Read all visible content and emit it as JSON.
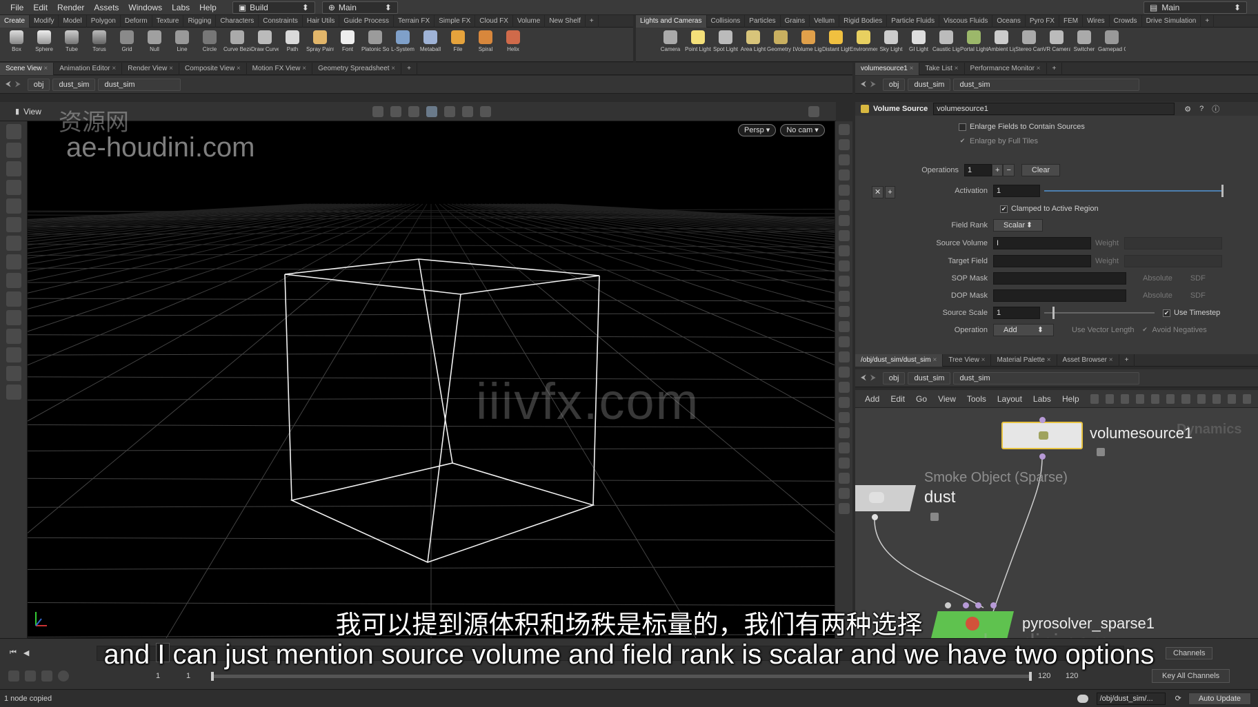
{
  "menubar": {
    "items": [
      "File",
      "Edit",
      "Render",
      "Assets",
      "Windows",
      "Labs",
      "Help"
    ],
    "desktop_build": "Build",
    "desktop_main": "Main",
    "right_desktop": "Main"
  },
  "shelf_left": {
    "tabs": [
      "Create",
      "Modify",
      "Model",
      "Polygon",
      "Deform",
      "Texture",
      "Rigging",
      "Characters",
      "Constraints",
      "Hair Utils",
      "Guide Process",
      "Terrain FX",
      "Simple FX",
      "Cloud FX",
      "Volume",
      "New Shelf"
    ],
    "tools": [
      "Box",
      "Sphere",
      "Tube",
      "Torus",
      "Grid",
      "Null",
      "Line",
      "Circle",
      "Curve Bezier",
      "Draw Curve",
      "Path",
      "Spray Paint",
      "Font",
      "Platonic Solids",
      "L-System",
      "Metaball",
      "File",
      "Spiral",
      "Helix"
    ]
  },
  "shelf_right": {
    "tabs": [
      "Lights and Cameras",
      "Collisions",
      "Particles",
      "Grains",
      "Vellum",
      "Rigid Bodies",
      "Particle Fluids",
      "Viscous Fluids",
      "Oceans",
      "Pyro FX",
      "FEM",
      "Wires",
      "Crowds",
      "Drive Simulation"
    ],
    "tools": [
      "Camera",
      "Point Light",
      "Spot Light",
      "Area Light",
      "Geometry Light",
      "Volume Light",
      "Distant Light",
      "Environment Light",
      "Sky Light",
      "GI Light",
      "Caustic Light",
      "Portal Light",
      "Ambient Light",
      "Stereo Camera",
      "VR Camera",
      "Switcher",
      "Gamepad Camera"
    ]
  },
  "left_pane": {
    "tabs": [
      "Scene View",
      "Animation Editor",
      "Render View",
      "Composite View",
      "Motion FX View",
      "Geometry Spreadsheet"
    ],
    "path": [
      "obj",
      "dust_sim",
      "dust_sim"
    ],
    "view_label": "View",
    "persp": "Persp",
    "nocam": "No cam"
  },
  "param_pane": {
    "tabs": [
      "volumesource1",
      "Take List",
      "Performance Monitor"
    ],
    "path": [
      "obj",
      "dust_sim",
      "dust_sim"
    ],
    "node_type": "Volume Source",
    "node_name": "volumesource1",
    "enlarge_fields": "Enlarge Fields to Contain Sources",
    "enlarge_tiles": "Enlarge by Full Tiles",
    "operations_label": "Operations",
    "operations_value": "1",
    "clear": "Clear",
    "activation_label": "Activation",
    "activation_value": "1",
    "clamped": "Clamped to Active Region",
    "field_rank_label": "Field Rank",
    "field_rank_value": "Scalar",
    "source_volume_label": "Source Volume",
    "target_field_label": "Target Field",
    "weight": "Weight",
    "sop_mask_label": "SOP Mask",
    "dop_mask_label": "DOP Mask",
    "absolute": "Absolute",
    "sdf": "SDF",
    "source_scale_label": "Source Scale",
    "source_scale_value": "1",
    "use_timestep": "Use Timestep",
    "operation_label": "Operation",
    "operation_value": "Add",
    "use_vector_length": "Use Vector Length",
    "avoid_negatives": "Avoid Negatives"
  },
  "net_pane": {
    "tabs": [
      "/obj/dust_sim/dust_sim",
      "Tree View",
      "Material Palette",
      "Asset Browser"
    ],
    "path": [
      "obj",
      "dust_sim",
      "dust_sim"
    ],
    "menu": [
      "Add",
      "Edit",
      "Go",
      "View",
      "Tools",
      "Layout",
      "Labs",
      "Help"
    ],
    "context_label": "Dynamics",
    "nodes": {
      "volumesource": "volumesource1",
      "dust_type": "Smoke Object (Sparse)",
      "dust": "dust",
      "pyrosolver": "pyrosolver_sparse1"
    }
  },
  "timeline": {
    "frame": "1",
    "start": "1",
    "end": "120",
    "end2": "120",
    "channels": "Channels",
    "key_all": "Key All Channels"
  },
  "status": {
    "message": "1 node copied",
    "path": "/obj/dust_sim/...",
    "auto_update": "Auto Update"
  },
  "watermarks": {
    "cn": "资源网",
    "site": "ae-houdini.com",
    "center": "iiivfx.com"
  },
  "subtitles": {
    "zh": "我可以提到源体积和场秩是标量的，我们有两种选择",
    "en": "and I can just mention source volume and field rank is scalar and we have two options"
  }
}
